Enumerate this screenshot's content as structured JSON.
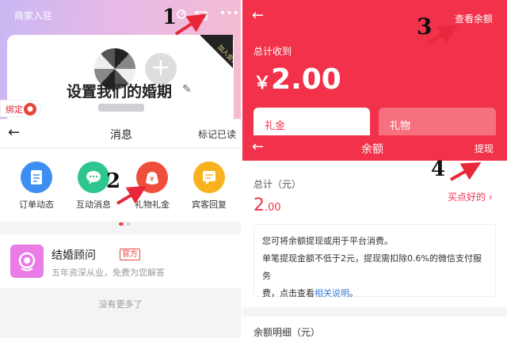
{
  "left": {
    "merchant_entry": "商家入驻",
    "profile": {
      "title": "设置我们的婚期",
      "vip_label": "加入会员",
      "bind_label": "绑定"
    },
    "messages": {
      "back": "←",
      "title": "消息",
      "mark_read": "标记已读",
      "categories": [
        {
          "label": "订单动态",
          "color": "#3d8ef0"
        },
        {
          "label": "互动消息",
          "color": "#2ec58f"
        },
        {
          "label": "礼物礼金",
          "color": "#ee4e3b"
        },
        {
          "label": "宾客回复",
          "color": "#f7b21d"
        }
      ]
    },
    "consultant": {
      "name": "结婚顾问",
      "badge": "官方",
      "desc": "五年资深从业，免费为您解答"
    },
    "no_more": "没有更多了"
  },
  "right": {
    "top": {
      "back": "←",
      "view_balance": "查看余额",
      "total_label": "总计收到",
      "currency": "￥",
      "amount": "2.00",
      "tabs": [
        "礼金",
        "礼物"
      ]
    },
    "balance": {
      "back": "←",
      "title": "余额",
      "withdraw": "提现",
      "total_label": "总计（元）",
      "value_int": "2",
      "value_dec": ".00",
      "buy_link": "买点好的 ›",
      "notice_line1": "您可将余额提现或用于平台消费。",
      "notice_line2": "单笔提现金额不低于2元，提现需扣除0.6%的微信支付服务",
      "notice_line3_pre": "费，点击查看",
      "notice_link": "相关说明",
      "notice_line3_post": "。",
      "detail_label": "余额明细（元）"
    }
  },
  "annotations": [
    "1",
    "2",
    "3",
    "4"
  ]
}
